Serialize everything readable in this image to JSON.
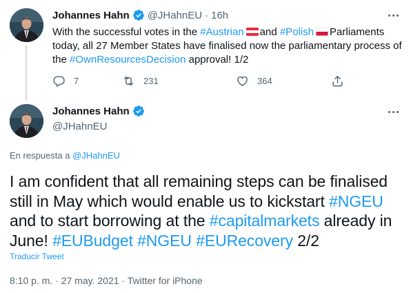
{
  "tweet1": {
    "author_name": "Johannes Hahn",
    "handle": "@JHahnEU",
    "separator": "·",
    "time": "16h",
    "text": {
      "part1": "With the successful votes in the ",
      "tag_austrian": "#Austrian",
      "part2": "and ",
      "tag_polish": "#Polish",
      "part3": "Parliaments today, all 27 Member States have finalised now the parliamentary process of the ",
      "tag_ownresources": "#OwnResourcesDecision",
      "part4": " approval! 1/2"
    },
    "flags": {
      "austria": "flag-austria",
      "poland": "flag-poland"
    },
    "actions": {
      "reply_count": "7",
      "retweet_count": "231",
      "like_count": "364"
    }
  },
  "tweet2": {
    "author_name": "Johannes Hahn",
    "handle": "@JHahnEU",
    "reply_prefix": "En respuesta a ",
    "reply_handle": "@JHahnEU",
    "text": {
      "part1": "I am confident that all remaining steps can be finalised still in May which would enable us to kickstart ",
      "tag_ngeu1": "#NGEU",
      "part2": " and to start borrowing at the ",
      "tag_capitalmarkets": "#capitalmarkets",
      "part3": " already in June! ",
      "tag_eubudget": "#EUBudget",
      "space1": " ",
      "tag_ngeu2": "#NGEU",
      "space2": " ",
      "tag_eurecovery": "#EURecovery",
      "part4": " 2/2"
    },
    "translate_label": "Traducir Tweet",
    "meta": {
      "time": "8:10 p. m.",
      "dot1": " · ",
      "date": "27 may. 2021",
      "dot2": " · ",
      "source": "Twitter for iPhone"
    }
  },
  "colors": {
    "link": "#1d9bf0",
    "muted": "#536471",
    "text": "#0f1419",
    "verified": "#1d9bf0"
  },
  "icons": [
    "verified-badge-icon",
    "more-icon",
    "reply-icon",
    "retweet-icon",
    "like-icon",
    "share-icon"
  ]
}
